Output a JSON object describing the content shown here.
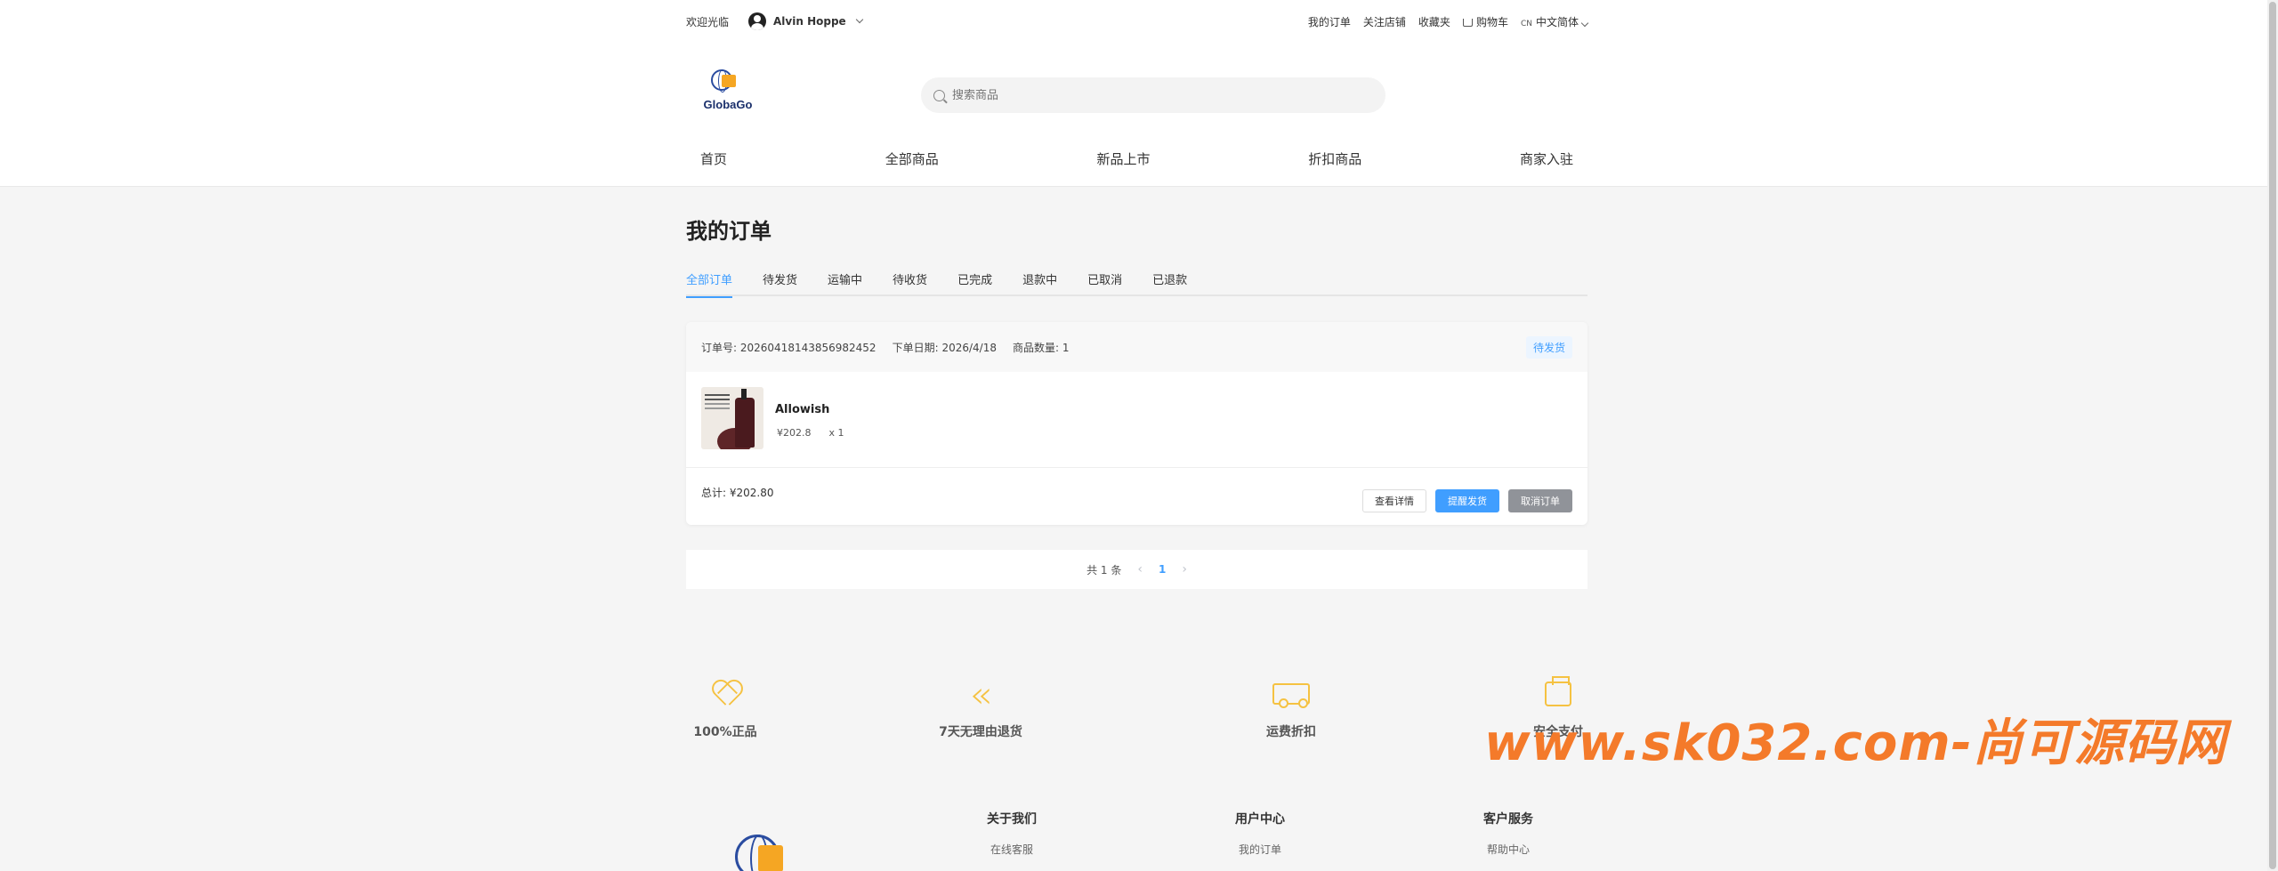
{
  "topbar": {
    "welcome": "欢迎光临",
    "username": "Alvin Hoppe",
    "links": [
      "我的订单",
      "关注店铺",
      "收藏夹"
    ],
    "cart": "购物车",
    "lang_code": "CN",
    "lang": "中文简体"
  },
  "logo": {
    "text": "GlobaGo"
  },
  "search": {
    "placeholder": "搜索商品"
  },
  "nav": [
    "首页",
    "全部商品",
    "新品上市",
    "折扣商品",
    "商家入驻"
  ],
  "page": {
    "title": "我的订单"
  },
  "tabs": [
    "全部订单",
    "待发货",
    "运输中",
    "待收货",
    "已完成",
    "退款中",
    "已取消",
    "已退款"
  ],
  "active_tab": 0,
  "order": {
    "id_label": "订单号:",
    "id": "20260418143856982452",
    "date_label": "下单日期:",
    "date": "2026/4/18",
    "qty_label": "商品数量:",
    "qty": "1",
    "status": "待发货",
    "product": {
      "name": "Allowish",
      "price": "¥202.8",
      "count": "x 1"
    },
    "total_label": "总计:",
    "total": "¥202.80",
    "buttons": {
      "detail": "查看详情",
      "remind": "提醒发货",
      "cancel": "取消订单"
    }
  },
  "pager": {
    "total": "共 1 条",
    "current": "1"
  },
  "features": [
    "100%正品",
    "7天无理由退货",
    "运费折扣",
    "安全支付"
  ],
  "footer": {
    "columns": [
      {
        "title": "关于我们",
        "item": "在线客服"
      },
      {
        "title": "用户中心",
        "item": "我的订单"
      },
      {
        "title": "客户服务",
        "item": "帮助中心"
      }
    ]
  },
  "watermark": "www.sk032.com-尚可源码网",
  "colors": {
    "accent": "#409eff",
    "feature_icon": "#f5c242",
    "watermark": "#f47a2a"
  }
}
